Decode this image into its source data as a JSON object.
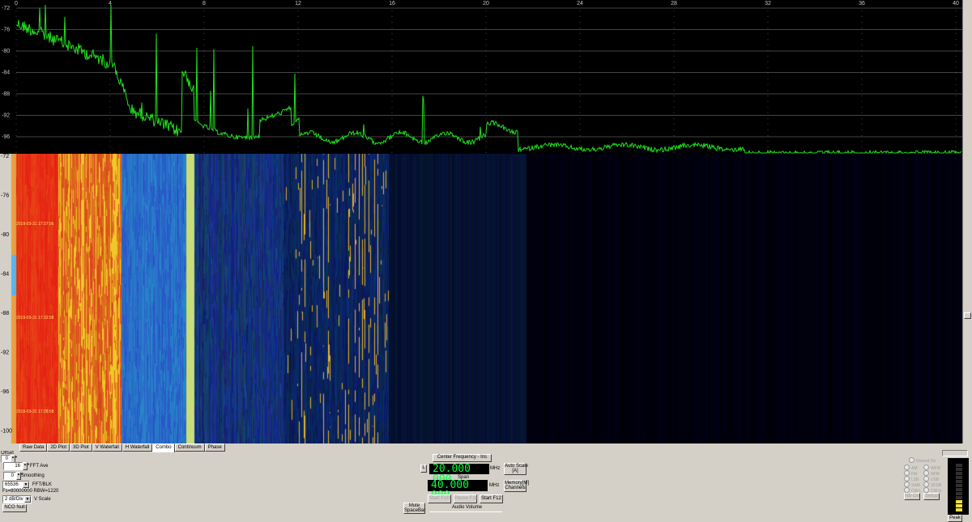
{
  "spectrum": {
    "x_ticks": [
      "0",
      "4",
      "8",
      "12",
      "16",
      "20",
      "24",
      "28",
      "32",
      "36",
      "40"
    ],
    "y_ticks": [
      "-72",
      "-76",
      "-80",
      "-84",
      "-88",
      "-92",
      "-96"
    ],
    "trace_color": "#22e01e"
  },
  "waterfall": {
    "y_ticks": [
      "-72",
      "-76",
      "-80",
      "-84",
      "-88",
      "-92",
      "-96",
      "-100"
    ],
    "timestamps": [
      "2019-03-31  17:37:06",
      "2019-03-31  17:32:58",
      "2019-03-31  17:28:58"
    ]
  },
  "tabs": [
    "Raw Data",
    "2D Plot",
    "3D Plot",
    "V Waterfall",
    "H Waterfall",
    "Combo",
    "Continuum",
    "Phase"
  ],
  "active_tab": "Combo",
  "left_controls": {
    "offset_label": "Offset",
    "offset_value": "0",
    "fft_ave_value": "16",
    "fft_ave_label": "FFT Ave",
    "smoothing_value": "0",
    "smoothing_label": "Smoothing",
    "fft_blk_value": "65536",
    "fft_blk_label": "FFT/BLK",
    "fs_rbw": "Fs=80000000 RBW=1220",
    "vscale_value": "2 dB/Div",
    "vscale_label": "V Scale",
    "nco_null": "NCO Null"
  },
  "center": {
    "center_freq_button": "Center Frequency - Ins",
    "l_label": "L",
    "center_freq_value": "20.000 000",
    "center_unit": "MHz",
    "auto_scale": "Auto Scale",
    "auto_scale_key": "[A]",
    "span_label": "Span",
    "span_value": "40.000 000",
    "span_unit": "MHz",
    "memory": "Memory[M]",
    "channels": "Channels",
    "start_f10": "Start F10",
    "pause_f11": "Pause F11",
    "start_f12": "Start F12",
    "mute": "Mute",
    "spacebar": "SpaceBar",
    "audio_volume": "Audio Volume"
  },
  "right_controls": {
    "demod_on": "Demod On",
    "modes_left": [
      "AM",
      "FM",
      "LSB",
      "SAM",
      "CW-L"
    ],
    "modes_right": [
      "WFM",
      "NFM",
      "USB",
      "SFSB",
      "CW-U"
    ],
    "nb_on": "NB On",
    "setup": "Setup",
    "peak": "Peak"
  }
}
